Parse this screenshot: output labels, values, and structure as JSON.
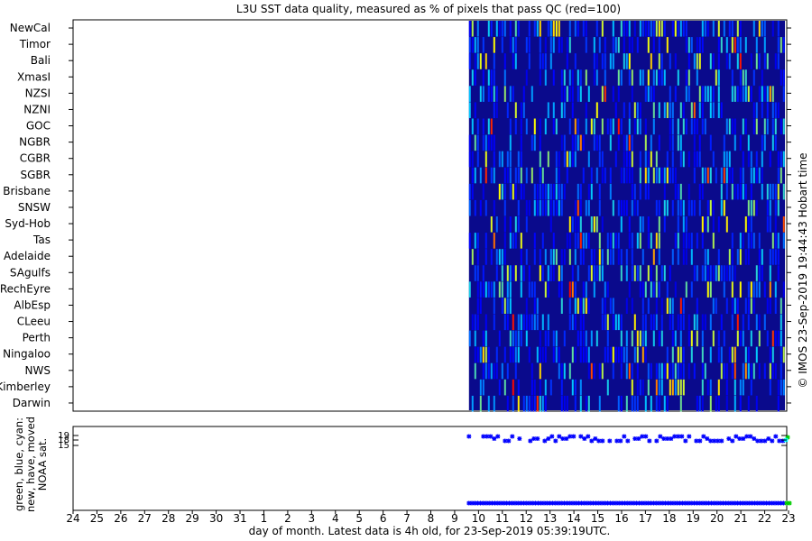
{
  "chart_data": [
    {
      "type": "heatmap",
      "title": "L3U SST data quality, measured as % of pixels that pass QC (red=100)",
      "regions": [
        "NewCal",
        "Timor",
        "Bali",
        "XmasI",
        "NZSI",
        "NZNI",
        "GOC",
        "NGBR",
        "CGBR",
        "SGBR",
        "Brisbane",
        "SNSW",
        "Syd-Hob",
        "Tas",
        "Adelaide",
        "SAgulfs",
        "RechEyre",
        "AlbEsp",
        "CLeeu",
        "Perth",
        "Ningaloo",
        "NWS",
        "Kimberley",
        "Darwin"
      ],
      "x_tick_labels": [
        "24",
        "25",
        "26",
        "27",
        "28",
        "29",
        "30",
        "31",
        "1",
        "2",
        "3",
        "4",
        "5",
        "6",
        "7",
        "8",
        "9",
        "10",
        "11",
        "12",
        "13",
        "14",
        "15",
        "16",
        "17",
        "18",
        "19",
        "20",
        "21",
        "22",
        "23"
      ],
      "data_start_day_offset": 16.6,
      "data_end_day_offset": 29.85,
      "value_scale": [
        0,
        100
      ],
      "color_low": "#000080",
      "color_high": "#ff0000",
      "note_axis": "day of month. Latest data is 4h old, for 23-Sep-2019 05:39:19UTC."
    },
    {
      "type": "scatter",
      "ylabel_lines": [
        "green, blue, cyan:",
        "new, have, moved",
        "NOAA sat."
      ],
      "y_tick_labels": [
        "19",
        "18",
        "15"
      ],
      "series_colors": {
        "new": "#00cc00",
        "have": "#0000ff",
        "moved": "#00ffff"
      }
    }
  ],
  "credit": "© IMOS 23-Sep-2019 19:44:43 Hobart time"
}
